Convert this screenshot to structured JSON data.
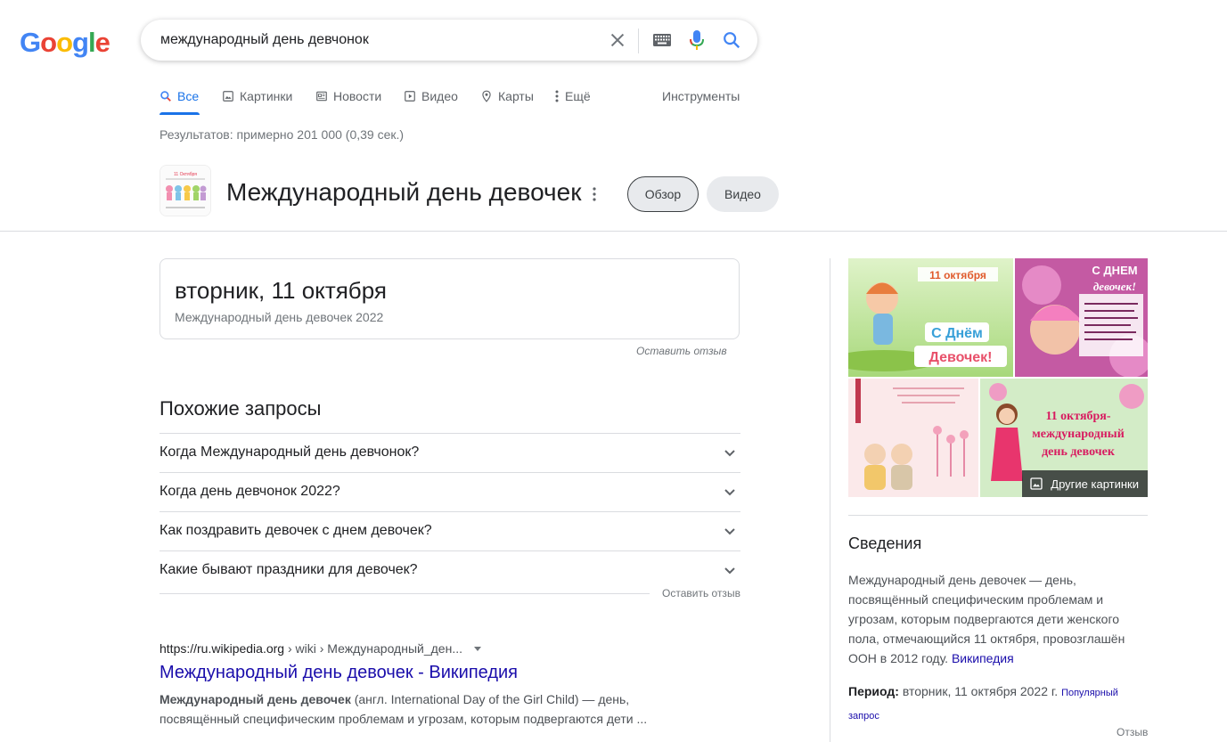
{
  "logo": {
    "letters": [
      "G",
      "o",
      "o",
      "g",
      "l",
      "e"
    ],
    "colors": [
      "#4285F4",
      "#EA4335",
      "#FBBC05",
      "#4285F4",
      "#34A853",
      "#EA4335"
    ]
  },
  "search": {
    "query": "международный день девчонок"
  },
  "tabs": [
    {
      "label": "Все",
      "icon": "search-icon",
      "active": true
    },
    {
      "label": "Картинки",
      "icon": "image-icon"
    },
    {
      "label": "Новости",
      "icon": "news-icon"
    },
    {
      "label": "Видео",
      "icon": "play-icon"
    },
    {
      "label": "Карты",
      "icon": "map-pin-icon"
    },
    {
      "label": "Ещё",
      "icon": "more-vert-icon"
    }
  ],
  "tools_label": "Инструменты",
  "stats": "Результатов: примерно 201 000 (0,39 сек.)",
  "entity": {
    "title": "Международный день девочек",
    "chips": [
      "Обзор",
      "Видео"
    ],
    "thumb_caption": "11 Октября"
  },
  "date_card": {
    "date": "вторник, 11 октября",
    "subtitle": "Международный день девочек 2022",
    "feedback": "Оставить отзыв"
  },
  "related": {
    "title": "Похожие запросы",
    "items": [
      "Когда Международный день девчонок?",
      "Когда день девчонок 2022?",
      "Как поздравить девочек с днем девочек?",
      "Какие бывают праздники для девочек?"
    ],
    "feedback": "Оставить отзыв"
  },
  "result": {
    "cite_domain": "https://ru.wikipedia.org",
    "cite_path": " › wiki › Международный_ден...",
    "title": "Международный день девочек - Википедия",
    "snippet_bold": "Международный день девочек",
    "snippet_rest": " (англ. International Day of the Girl Child) — день, посвящённый специфическим проблемам и угрозам, которым подвергаются дети ..."
  },
  "panel": {
    "images": {
      "img1_text": [
        "11 октября",
        "С Днём",
        "Девочек!"
      ],
      "img2_text": [
        "С ДНЕМ",
        "девочек!"
      ],
      "img4_text": [
        "11 октября-",
        "международный",
        "день девочек"
      ],
      "more_label": "Другие картинки"
    },
    "title": "Сведения",
    "desc": "Международный день девочек — день, посвящённый специфическим проблемам и угрозам, которым подвергаются дети женского пола, отмечающийся 11 октября, провозглашён ООН в 2012 году.",
    "desc_link": "Википедия",
    "period_label": "Период:",
    "period_value": "вторник, 11 октября 2022 г.",
    "period_link": "Популярный запрос",
    "feedback": "Отзыв"
  }
}
